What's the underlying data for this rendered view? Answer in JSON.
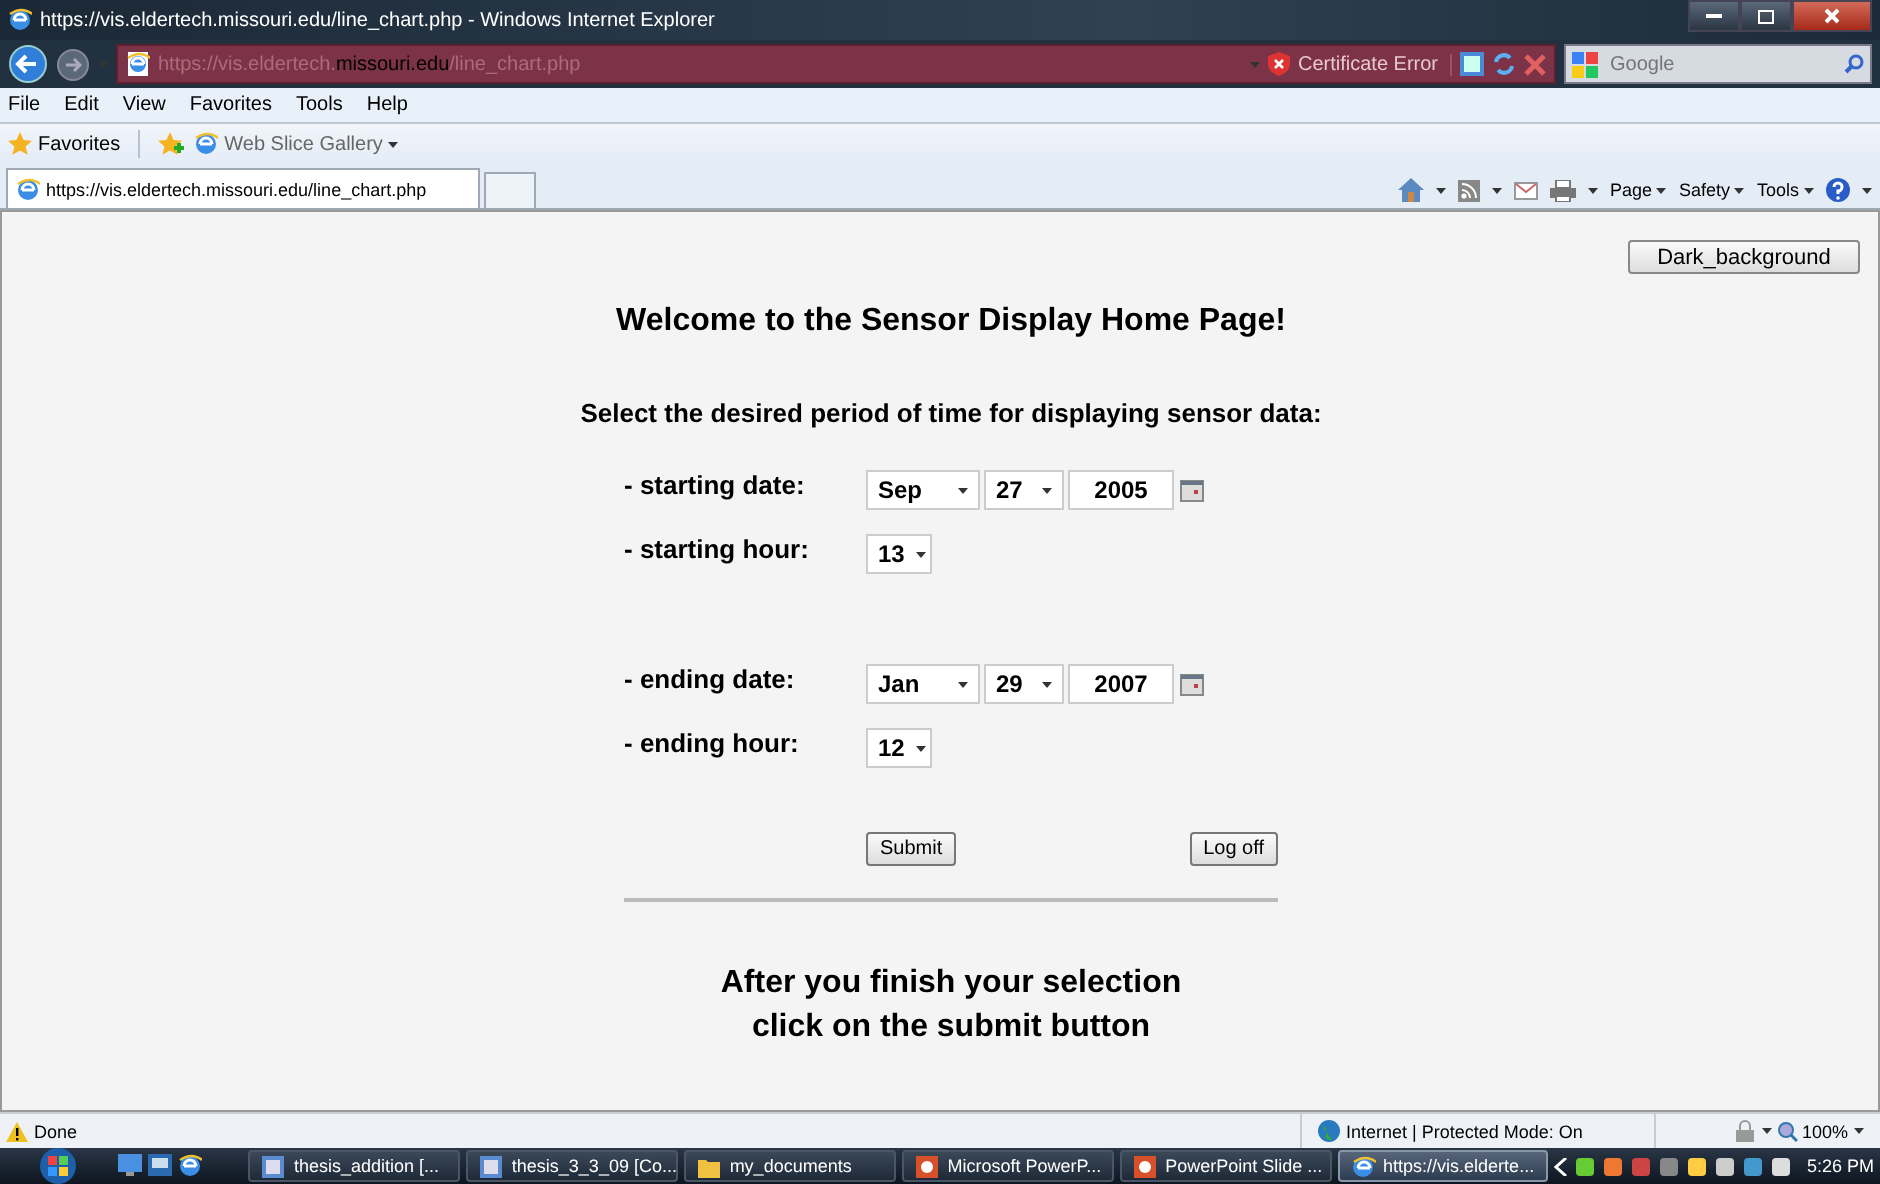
{
  "window": {
    "title": "https://vis.eldertech.missouri.edu/line_chart.php - Windows Internet Explorer"
  },
  "address_bar": {
    "url_parts": [
      {
        "text": "https://vis.eldertech.",
        "kind": "dim"
      },
      {
        "text": "missouri.edu",
        "kind": "domain"
      },
      {
        "text": "/line_chart.php",
        "kind": "dim"
      }
    ],
    "security": "Certificate Error"
  },
  "search": {
    "placeholder": "Google"
  },
  "menu_bar": [
    "File",
    "Edit",
    "View",
    "Favorites",
    "Tools",
    "Help"
  ],
  "favorites_bar": {
    "favorites": "Favorites",
    "items": [
      "Web Slice Gallery"
    ]
  },
  "tabs": [
    {
      "label": "https://vis.eldertech.missouri.edu/line_chart.php",
      "selected": true
    }
  ],
  "command_bar": [
    "Page",
    "Safety",
    "Tools"
  ],
  "page": {
    "theme_button": "Dark_background",
    "heading": "Welcome to the Sensor Display Home Page!",
    "prompt": "Select the desired period of time for displaying sensor data:",
    "periods": [
      {
        "rows": [
          {
            "kind": "date",
            "label": "- starting date:",
            "month": "Sep",
            "day": "27",
            "year": "2005"
          },
          {
            "kind": "hour",
            "label": "- starting hour:",
            "hour": "13"
          }
        ]
      },
      {
        "rows": [
          {
            "kind": "date",
            "label": "- ending date:",
            "month": "Jan",
            "day": "29",
            "year": "2007"
          },
          {
            "kind": "hour",
            "label": "- ending hour:",
            "hour": "12"
          }
        ]
      }
    ],
    "buttons": [
      "Submit",
      "Log off"
    ],
    "footer": [
      "After you finish your selection",
      "click on the submit button"
    ]
  },
  "status_bar": {
    "text": "Done",
    "zone": "Internet | Protected Mode: On",
    "zoom": "100%"
  },
  "taskbar": {
    "items": [
      {
        "label": "thesis_addition [...",
        "kind": "word",
        "selected": false
      },
      {
        "label": "thesis_3_3_09 [Co...",
        "kind": "word",
        "selected": false
      },
      {
        "label": "my_documents",
        "kind": "folder",
        "selected": false
      },
      {
        "label": "Microsoft PowerP...",
        "kind": "powerpoint",
        "selected": false
      },
      {
        "label": "PowerPoint Slide ...",
        "kind": "powerpoint",
        "selected": false
      },
      {
        "label": "https://vis.elderte...",
        "kind": "ie",
        "selected": true
      }
    ],
    "clock": "5:26 PM"
  }
}
